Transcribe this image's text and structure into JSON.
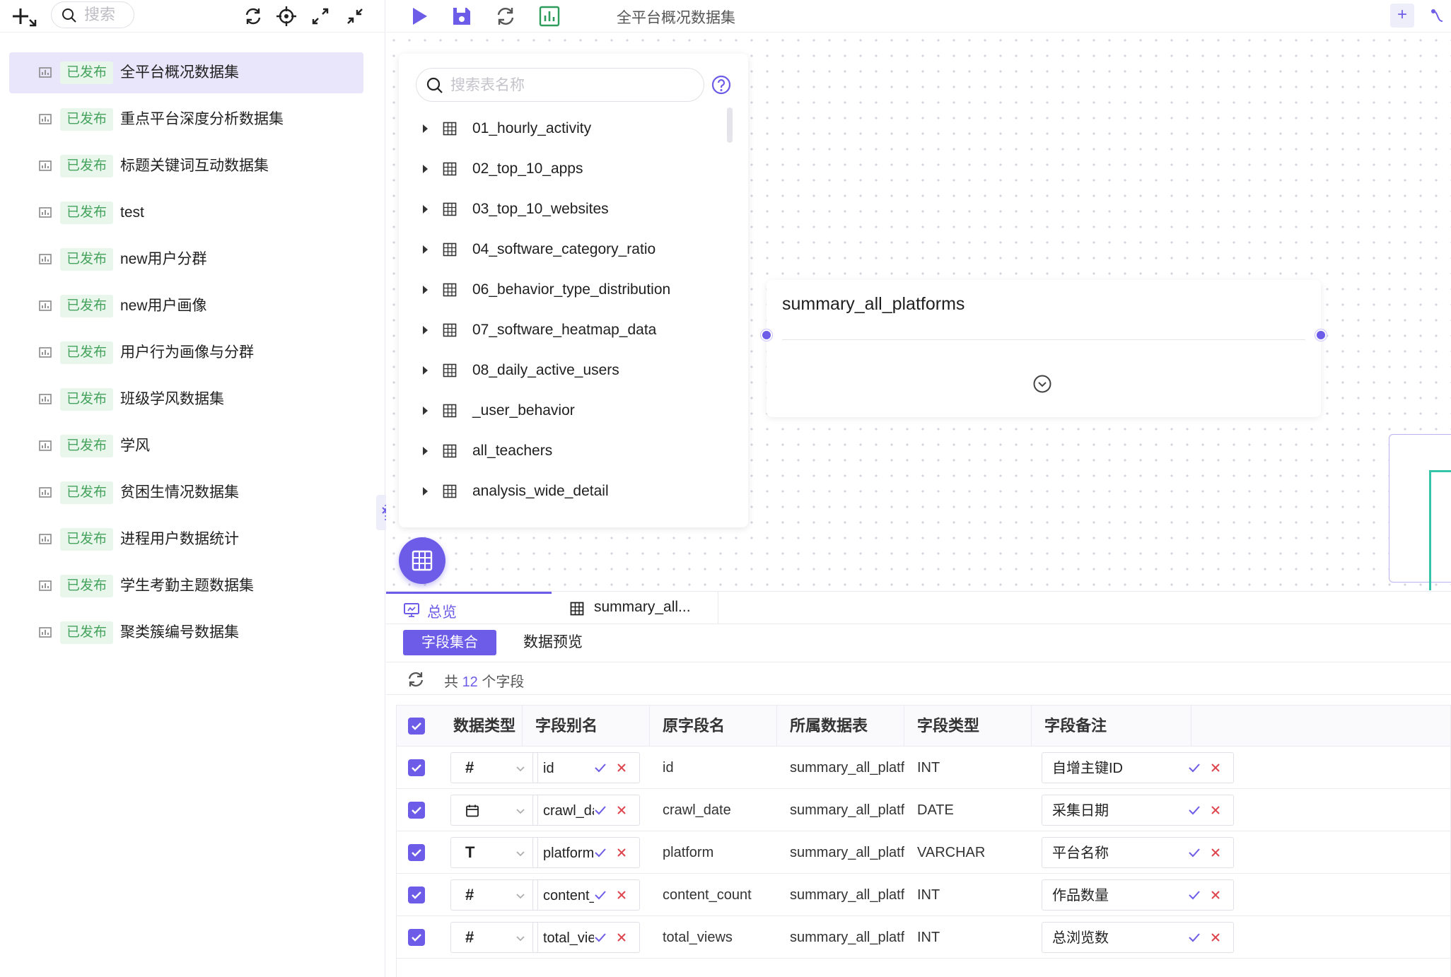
{
  "left": {
    "search_placeholder": "搜索",
    "datasets": [
      {
        "badge": "已发布",
        "name": "全平台概况数据集",
        "selected": true
      },
      {
        "badge": "已发布",
        "name": "重点平台深度分析数据集"
      },
      {
        "badge": "已发布",
        "name": "标题关键词互动数据集"
      },
      {
        "badge": "已发布",
        "name": "test"
      },
      {
        "badge": "已发布",
        "name": "new用户分群"
      },
      {
        "badge": "已发布",
        "name": "new用户画像"
      },
      {
        "badge": "已发布",
        "name": "用户行为画像与分群"
      },
      {
        "badge": "已发布",
        "name": "班级学风数据集"
      },
      {
        "badge": "已发布",
        "name": "学风"
      },
      {
        "badge": "已发布",
        "name": "贫困生情况数据集"
      },
      {
        "badge": "已发布",
        "name": "进程用户数据统计"
      },
      {
        "badge": "已发布",
        "name": "学生考勤主题数据集"
      },
      {
        "badge": "已发布",
        "name": "聚类簇编号数据集"
      }
    ]
  },
  "toolbar": {
    "title": "全平台概况数据集",
    "plus": "+"
  },
  "table_panel": {
    "search_placeholder": "搜索表名称",
    "tables": [
      "01_hourly_activity",
      "02_top_10_apps",
      "03_top_10_websites",
      "04_software_category_ratio",
      "06_behavior_type_distribution",
      "07_software_heatmap_data",
      "08_daily_active_users",
      "_user_behavior",
      "all_teachers",
      "analysis_wide_detail"
    ]
  },
  "node": {
    "title": "summary_all_platforms"
  },
  "bottom": {
    "tab_overview": "总览",
    "tab_table": "summary_all...",
    "subtab_fields": "字段集合",
    "subtab_preview": "数据预览",
    "count_prefix": "共 ",
    "count_value": "12",
    "count_suffix": " 个字段",
    "columns": [
      "数据类型",
      "字段别名",
      "原字段名",
      "所属数据表",
      "字段类型",
      "字段备注"
    ],
    "rows": [
      {
        "type_glyph": "#",
        "alias": "id",
        "original": "id",
        "table": "summary_all_platfo...",
        "field_type": "INT",
        "remark": "自增主键ID"
      },
      {
        "type_glyph": "calendar",
        "alias": "crawl_date",
        "original": "crawl_date",
        "table": "summary_all_platfo...",
        "field_type": "DATE",
        "remark": "采集日期"
      },
      {
        "type_glyph": "T",
        "alias": "platform",
        "original": "platform",
        "table": "summary_all_platfo...",
        "field_type": "VARCHAR",
        "remark": "平台名称"
      },
      {
        "type_glyph": "#",
        "alias": "content_count",
        "original": "content_count",
        "table": "summary_all_platfo...",
        "field_type": "INT",
        "remark": "作品数量"
      },
      {
        "type_glyph": "#",
        "alias": "total_views",
        "original": "total_views",
        "table": "summary_all_platfo...",
        "field_type": "INT",
        "remark": "总浏览数"
      }
    ]
  },
  "colors": {
    "accent": "#6c5ce7",
    "badge_bg": "#e9f6ec",
    "badge_text": "#45a35d",
    "minimap_line": "#35c4a8"
  }
}
